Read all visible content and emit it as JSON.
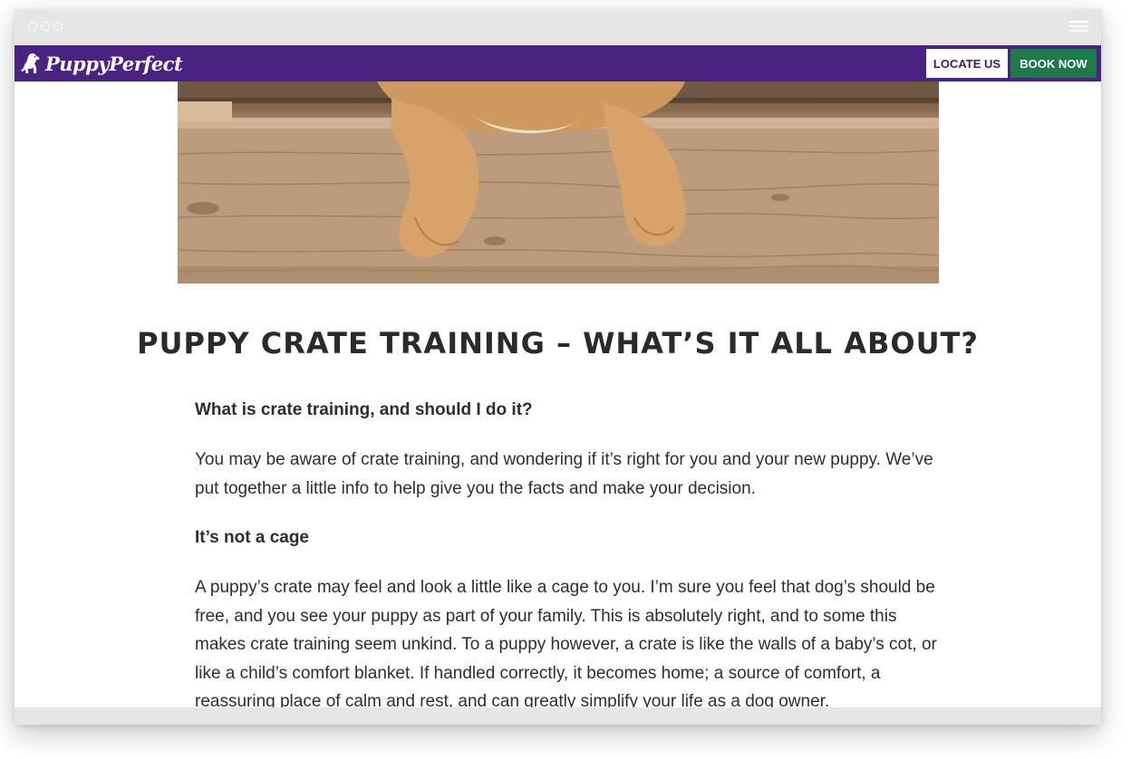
{
  "browser": {
    "menu_icon": "hamburger-icon"
  },
  "nav": {
    "brand": "PuppyPerfect",
    "brand_icon": "dog-logo-icon",
    "locate_label": "LOCATE US",
    "book_label": "BOOK NOW",
    "colors": {
      "bar": "#4a2380",
      "book": "#1f7a4a",
      "locate_text": "#3b1d6e"
    }
  },
  "article": {
    "title": "PUPPY CRATE TRAINING – WHAT’S IT ALL ABOUT?",
    "sections": [
      {
        "heading": "What is crate training, and should I do it?"
      },
      {
        "paragraph": "You may be aware of crate training, and wondering if it’s right for you and your new puppy. We’ve put together a little info to help give you the facts and make your decision."
      },
      {
        "heading": "It’s not a cage"
      },
      {
        "paragraph": "A puppy’s crate may feel and look a little like a cage to you. I’m sure you feel that dog’s should be free, and you see your puppy as part of your family. This is absolutely right, and to some this makes crate training seem unkind. To a puppy however, a crate is like the walls of a baby’s cot, or like a child’s comfort blanket. If handled correctly, it becomes home; a source of comfort, a reassuring place of calm and rest, and can greatly simplify your life as a dog owner."
      }
    ]
  }
}
